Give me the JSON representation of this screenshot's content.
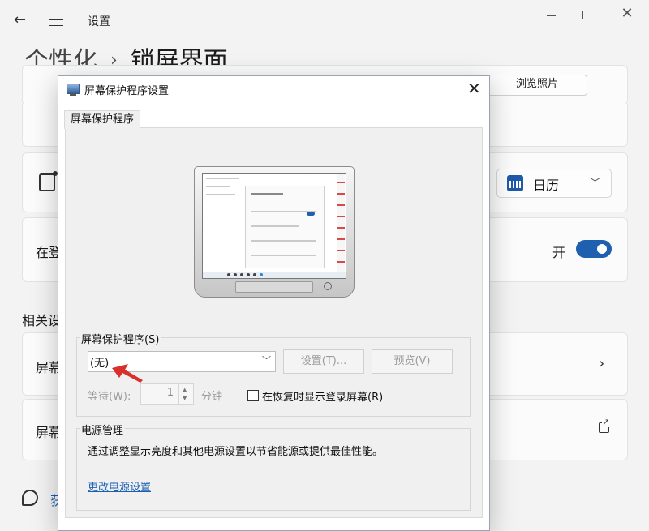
{
  "settings": {
    "app_title": "设置",
    "breadcrumb": {
      "parent": "个性化",
      "separator": "›",
      "current": "锁屏界面"
    },
    "browse_button": "浏览照片",
    "calendar_dropdown": {
      "value": "日历"
    },
    "signin_row_label": "在登",
    "toggle": {
      "label": "开",
      "state": "on"
    },
    "related_section": "相关设",
    "related_rows": [
      "屏幕",
      "屏幕"
    ],
    "help_text": "获",
    "accent_color": "#1f5fb0"
  },
  "dialog": {
    "title": "屏幕保护程序设置",
    "tab": "屏幕保护程序",
    "saver_group_label": "屏幕保护程序(S)",
    "saver_value": "(无)",
    "settings_button": "设置(T)...",
    "preview_button": "预览(V)",
    "wait_label": "等待(W):",
    "wait_value": "1",
    "wait_unit": "分钟",
    "resume_checkbox_label": "在恢复时显示登录屏幕(R)",
    "resume_checked": false,
    "power_group_label": "电源管理",
    "power_description": "通过调整显示亮度和其他电源设置以节省能源或提供最佳性能。",
    "power_link": "更改电源设置"
  }
}
